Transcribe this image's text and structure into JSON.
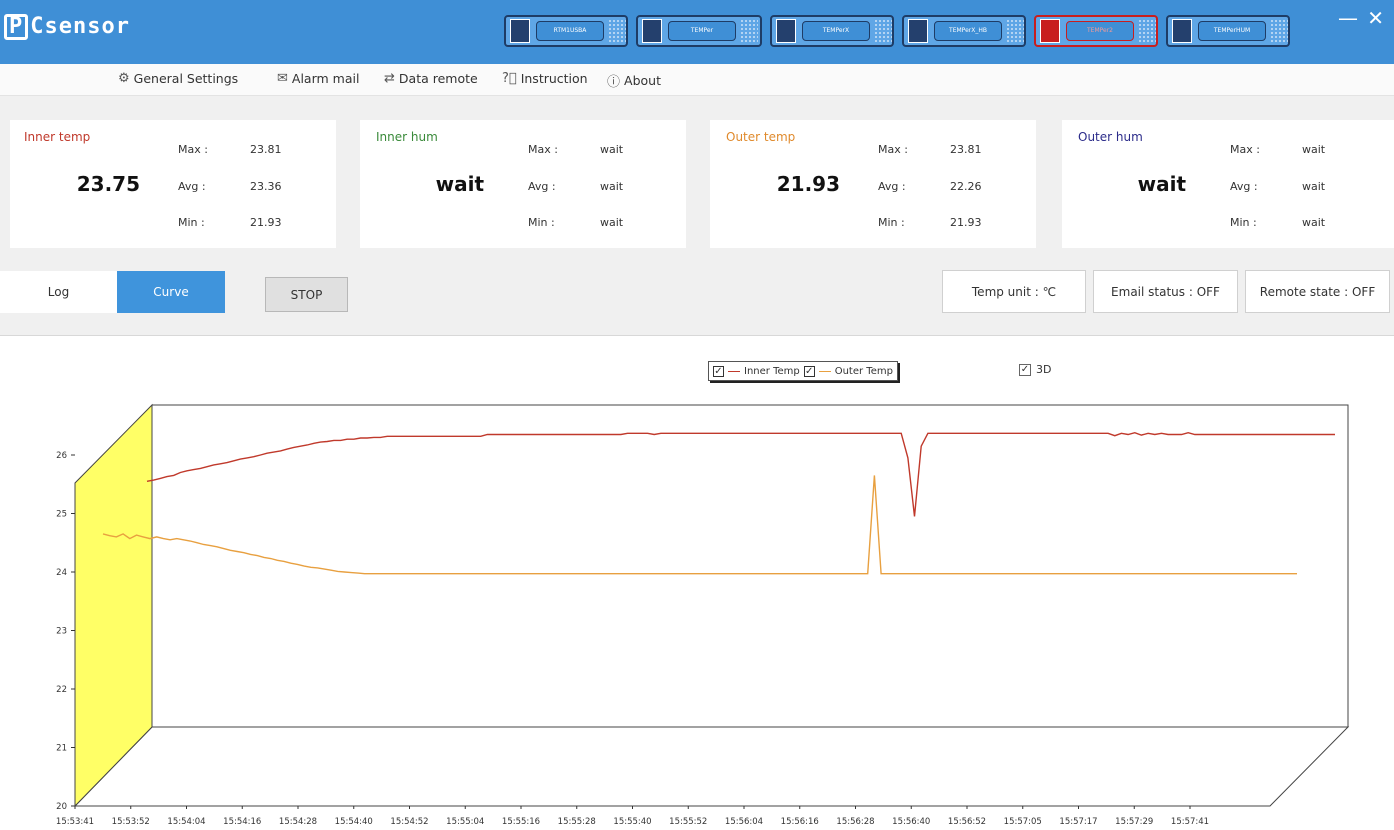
{
  "app": {
    "logo": "Csensor",
    "window": {
      "minimize": "—",
      "close": "✕"
    },
    "devices": [
      {
        "label": "RTM1USBA",
        "active": false
      },
      {
        "label": "TEMPer",
        "active": false
      },
      {
        "label": "TEMPerX",
        "active": false
      },
      {
        "label": "TEMPerX_HB",
        "active": false
      },
      {
        "label": "TEMPer2",
        "active": true
      },
      {
        "label": "TEMPerHUM",
        "active": false
      }
    ]
  },
  "menu": {
    "general_settings": "General Settings",
    "alarm_mail": "Alarm mail",
    "data_remote": "Data remote",
    "instruction": "Instruction",
    "about": "About"
  },
  "cards": {
    "inner_temp": {
      "name": "Inner temp",
      "color": "#c0392b",
      "value": "23.75",
      "max_label": "Max :",
      "max": "23.81",
      "avg_label": "Avg :",
      "avg": "23.36",
      "min_label": "Min :",
      "min": "21.93"
    },
    "inner_hum": {
      "name": "Inner hum",
      "color": "#3a8a3a",
      "value": "wait",
      "max_label": "Max :",
      "max": "wait",
      "avg_label": "Avg :",
      "avg": "wait",
      "min_label": "Min :",
      "min": "wait"
    },
    "outer_temp": {
      "name": "Outer temp",
      "color": "#e08a2c",
      "value": "21.93",
      "max_label": "Max :",
      "max": "23.81",
      "avg_label": "Avg :",
      "avg": "22.26",
      "min_label": "Min :",
      "min": "21.93"
    },
    "outer_hum": {
      "name": "Outer hum",
      "color": "#2c2c8a",
      "value": "wait",
      "max_label": "Max :",
      "max": "wait",
      "avg_label": "Avg :",
      "avg": "wait",
      "min_label": "Min :",
      "min": "wait"
    }
  },
  "controls": {
    "tab_log": "Log",
    "tab_curve": "Curve",
    "stop": "STOP",
    "temp_unit": "Temp unit : ℃",
    "email_status": "Email status : OFF",
    "remote_state": "Remote state : OFF"
  },
  "legend": {
    "inner": "Inner Temp",
    "outer": "Outer Temp",
    "inner_checked": "✓",
    "outer_checked": "✓",
    "three_d": "3D",
    "three_d_checked": "✓"
  },
  "chart_data": {
    "type": "line",
    "ylim": [
      20,
      26
    ],
    "yticks": [
      26,
      25,
      24,
      23,
      22,
      21,
      20
    ],
    "xlabels": [
      "15:53:41",
      "15:53:52",
      "15:54:04",
      "15:54:16",
      "15:54:28",
      "15:54:40",
      "15:54:52",
      "15:55:04",
      "15:55:16",
      "15:55:28",
      "15:55:40",
      "15:55:52",
      "15:56:04",
      "15:56:16",
      "15:56:28",
      "15:56:40",
      "15:56:52",
      "15:57:05",
      "15:57:17",
      "15:57:29",
      "15:57:41"
    ],
    "grid": false,
    "colors": {
      "inner": "#c0392b",
      "outer": "#e8a040",
      "wall": "#ffff66"
    },
    "series": [
      {
        "name": "Inner Temp",
        "x_start_index": 0.0,
        "x_step": 0.25,
        "values": [
          24.2,
          24.22,
          24.25,
          24.28,
          24.3,
          24.35,
          24.38,
          24.4,
          24.42,
          24.45,
          24.48,
          24.5,
          24.52,
          24.55,
          24.58,
          24.6,
          24.62,
          24.65,
          24.68,
          24.7,
          24.72,
          24.75,
          24.78,
          24.8,
          24.82,
          24.85,
          24.87,
          24.88,
          24.9,
          24.9,
          24.92,
          24.92,
          24.94,
          24.94,
          24.95,
          24.95,
          24.97,
          24.97,
          24.97,
          24.97,
          24.97,
          24.97,
          24.97,
          24.97,
          24.97,
          24.97,
          24.97,
          24.97,
          24.97,
          24.97,
          24.97,
          25.0,
          25.0,
          25.0,
          25.0,
          25.0,
          25.0,
          25.0,
          25.0,
          25.0,
          25.0,
          25.0,
          25.0,
          25.0,
          25.0,
          25.0,
          25.0,
          25.0,
          25.0,
          25.0,
          25.0,
          25.0,
          25.02,
          25.02,
          25.02,
          25.02,
          25.0,
          25.02,
          25.02,
          25.02,
          25.02,
          25.02,
          25.02,
          25.02,
          25.02,
          25.02,
          25.02,
          25.02,
          25.02,
          25.02,
          25.02,
          25.02,
          25.02,
          25.02,
          25.02,
          25.02,
          25.02,
          25.02,
          25.02,
          25.02,
          25.02,
          25.02,
          25.02,
          25.02,
          25.02,
          25.02,
          25.02,
          25.02,
          25.02,
          25.02,
          25.02,
          25.02,
          25.02,
          25.02,
          24.6,
          23.6,
          24.8,
          25.02,
          25.02,
          25.02,
          25.02,
          25.02,
          25.02,
          25.02,
          25.02,
          25.02,
          25.02,
          25.02,
          25.02,
          25.02,
          25.02,
          25.02,
          25.02,
          25.02,
          25.02,
          25.02,
          25.02,
          25.02,
          25.02,
          25.02,
          25.02,
          25.02,
          25.02,
          25.02,
          25.02,
          24.98,
          25.02,
          25.0,
          25.03,
          24.99,
          25.02,
          25.0,
          25.02,
          25.0,
          25.0,
          25.0,
          25.03,
          25.0,
          25.0,
          25.0,
          25.0,
          25.0,
          25.0,
          25.0,
          25.0,
          25.0,
          25.0,
          25.0,
          25.0,
          25.0,
          25.0,
          25.0,
          25.0,
          25.0,
          25.0,
          25.0,
          25.0,
          25.0,
          25.0
        ]
      },
      {
        "name": "Outer Temp",
        "x_start_index": 0.0,
        "x_step": 0.25,
        "values": [
          23.3,
          23.27,
          23.25,
          23.3,
          23.22,
          23.28,
          23.25,
          23.22,
          23.25,
          23.22,
          23.2,
          23.22,
          23.2,
          23.18,
          23.15,
          23.12,
          23.1,
          23.08,
          23.05,
          23.02,
          23.0,
          22.98,
          22.95,
          22.93,
          22.9,
          22.88,
          22.85,
          22.83,
          22.8,
          22.78,
          22.75,
          22.73,
          22.72,
          22.7,
          22.68,
          22.66,
          22.65,
          22.64,
          22.63,
          22.62,
          22.62,
          22.62,
          22.62,
          22.62,
          22.62,
          22.62,
          22.62,
          22.62,
          22.62,
          22.62,
          22.62,
          22.62,
          22.62,
          22.62,
          22.62,
          22.62,
          22.62,
          22.62,
          22.62,
          22.62,
          22.62,
          22.62,
          22.62,
          22.62,
          22.62,
          22.62,
          22.62,
          22.62,
          22.62,
          22.62,
          22.62,
          22.62,
          22.62,
          22.62,
          22.62,
          22.62,
          22.62,
          22.62,
          22.62,
          22.62,
          22.62,
          22.62,
          22.62,
          22.62,
          22.62,
          22.62,
          22.62,
          22.62,
          22.62,
          22.62,
          22.62,
          22.62,
          22.62,
          22.62,
          22.62,
          22.62,
          22.62,
          22.62,
          22.62,
          22.62,
          22.62,
          22.62,
          22.62,
          22.62,
          22.62,
          22.62,
          22.62,
          22.62,
          22.62,
          22.62,
          22.62,
          22.62,
          22.62,
          22.62,
          22.62,
          24.3,
          22.62,
          22.62,
          22.62,
          22.62,
          22.62,
          22.62,
          22.62,
          22.62,
          22.62,
          22.62,
          22.62,
          22.62,
          22.62,
          22.62,
          22.62,
          22.62,
          22.62,
          22.62,
          22.62,
          22.62,
          22.62,
          22.62,
          22.62,
          22.62,
          22.62,
          22.62,
          22.62,
          22.62,
          22.62,
          22.62,
          22.62,
          22.62,
          22.62,
          22.62,
          22.62,
          22.62,
          22.62,
          22.62,
          22.62,
          22.62,
          22.62,
          22.62,
          22.62,
          22.62,
          22.62,
          22.62,
          22.62,
          22.62,
          22.62,
          22.62,
          22.62,
          22.62,
          22.62,
          22.62,
          22.62,
          22.62,
          22.62,
          22.62,
          22.62,
          22.62,
          22.62,
          22.62,
          22.62
        ]
      }
    ]
  }
}
